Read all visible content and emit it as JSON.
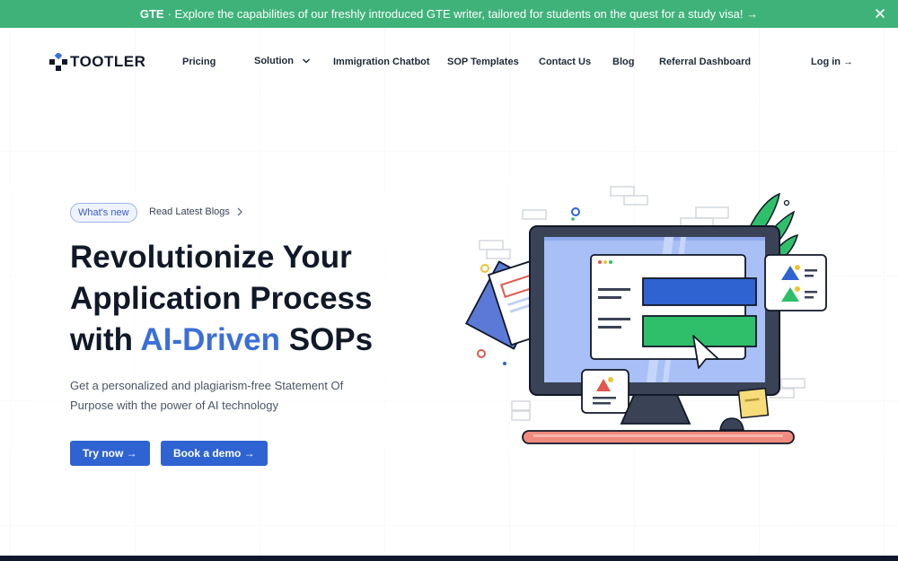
{
  "banner": {
    "tag": "GTE",
    "message": "· Explore the capabilities of our freshly introduced GTE writer, tailored for students on the quest for a study visa! →",
    "close_icon": "close-icon",
    "background": "#3fb27a"
  },
  "nav": {
    "logo_text": "TOOTLER",
    "items": [
      {
        "label": "Pricing"
      },
      {
        "label": "Solution"
      },
      {
        "label": "Immigration Chatbot"
      },
      {
        "label": "SOP Templates"
      },
      {
        "label": "Contact Us"
      },
      {
        "label": "Blog"
      },
      {
        "label": "Referral Dashboard"
      }
    ],
    "login": "Log in →"
  },
  "hero": {
    "pill": "What's new",
    "read_blogs": "Read Latest Blogs",
    "headline_line1": "Revolutionize Your",
    "headline_line2": "Application Process",
    "headline_line3_pre": "with ",
    "headline_accent": "AI-Driven",
    "headline_line3_post": " SOPs",
    "subtext": "Get a personalized and plagiarism-free Statement Of Purpose with the power of AI technology",
    "try_now": "Try now →",
    "book_demo": "Book a demo →",
    "accent_color": "#3a6fd8",
    "button_color": "#2f63d1"
  }
}
